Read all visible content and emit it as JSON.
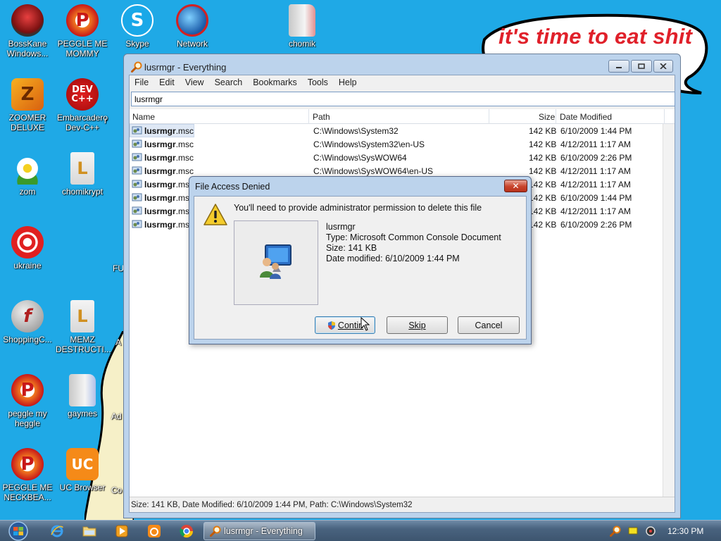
{
  "wallpaper": {
    "bubble_text": "it's time to eat shit"
  },
  "desktop_icons": [
    {
      "label": "BossKane Windows...",
      "icon": "bosskane-icon"
    },
    {
      "label": "PEGGLE ME MOMMY",
      "icon": "peggle-icon"
    },
    {
      "label": "Skype",
      "icon": "skype-icon"
    },
    {
      "label": "Network",
      "icon": "network-icon"
    },
    {
      "label": "chomik",
      "icon": "folder-icon"
    },
    {
      "label": "ZOOMER DELUXE",
      "icon": "zoomer-icon"
    },
    {
      "label": "Embarcadero Dev-C++",
      "icon": "devcpp-icon"
    },
    {
      "label": "zom",
      "icon": "flower-icon"
    },
    {
      "label": "chomikrypt",
      "icon": "shortcut-icon"
    },
    {
      "label": "ukraine",
      "icon": "radiation-icon"
    },
    {
      "label": "ShoppingC...",
      "icon": "flash-icon"
    },
    {
      "label": "MEMZ DESTRUCTI...",
      "icon": "shortcut-icon"
    },
    {
      "label": "peggle my heggle",
      "icon": "peggle-icon"
    },
    {
      "label": "gaymes",
      "icon": "folder-icon"
    },
    {
      "label": "PEGGLE ME NECKBEA...",
      "icon": "peggle-icon"
    },
    {
      "label": "UC Browser",
      "icon": "ucbrowser-icon"
    }
  ],
  "partial_icon_labels": [
    "r",
    "FU",
    "A",
    "Ad",
    "Co"
  ],
  "everything_window": {
    "title": "lusrmgr - Everything",
    "menu": [
      "File",
      "Edit",
      "View",
      "Search",
      "Bookmarks",
      "Tools",
      "Help"
    ],
    "search_value": "lusrmgr",
    "columns": {
      "name": "Name",
      "path": "Path",
      "size": "Size",
      "date": "Date Modified"
    },
    "rows": [
      {
        "name_bold": "lusrmgr",
        "name_ext": ".msc",
        "path": "C:\\Windows\\System32",
        "size": "142 KB",
        "date": "6/10/2009 1:44 PM"
      },
      {
        "name_bold": "lusrmgr",
        "name_ext": ".msc",
        "path": "C:\\Windows\\System32\\en-US",
        "size": "142 KB",
        "date": "4/12/2011 1:17 AM"
      },
      {
        "name_bold": "lusrmgr",
        "name_ext": ".msc",
        "path": "C:\\Windows\\SysWOW64",
        "size": "142 KB",
        "date": "6/10/2009 2:26 PM"
      },
      {
        "name_bold": "lusrmgr",
        "name_ext": ".msc",
        "path": "C:\\Windows\\SysWOW64\\en-US",
        "size": "142 KB",
        "date": "4/12/2011 1:17 AM"
      },
      {
        "name_bold": "lusrmgr",
        "name_ext": ".msc",
        "path": "",
        "size": "142 KB",
        "date": "4/12/2011 1:17 AM"
      },
      {
        "name_bold": "lusrmgr",
        "name_ext": ".msc",
        "path": "",
        "size": "142 KB",
        "date": "6/10/2009 1:44 PM"
      },
      {
        "name_bold": "lusrmgr",
        "name_ext": ".msc",
        "path": "",
        "size": "142 KB",
        "date": "4/12/2011 1:17 AM"
      },
      {
        "name_bold": "lusrmgr",
        "name_ext": ".msc",
        "path": "",
        "size": "142 KB",
        "date": "6/10/2009 2:26 PM"
      }
    ],
    "status": "Size: 141 KB, Date Modified: 6/10/2009 1:44 PM, Path: C:\\Windows\\System32"
  },
  "dialog": {
    "title": "File Access Denied",
    "message": "You'll need to provide administrator permission to delete this file",
    "file_name": "lusrmgr",
    "file_type": "Type: Microsoft Common Console Document",
    "file_size": "Size: 141 KB",
    "file_date": "Date modified: 6/10/2009 1:44 PM",
    "btn_continue": "Contin",
    "btn_skip": "Skip",
    "btn_cancel": "Cancel",
    "close_glyph": "✕"
  },
  "taskbar": {
    "active_task": "lusrmgr - Everything",
    "clock": "12:30 PM"
  },
  "colors": {
    "desktop": "#1fa9e6",
    "bubble_text": "#e0202a",
    "window_frame": "#bcd3ec",
    "close_red": "#c8432b"
  }
}
